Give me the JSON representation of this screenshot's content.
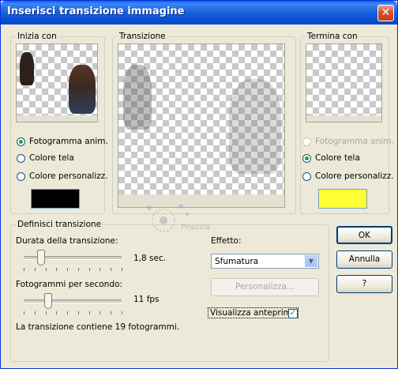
{
  "window": {
    "title": "Inserisci transizione immagine",
    "close_glyph": "✕"
  },
  "start_group": {
    "label": "Inizia con",
    "options": [
      {
        "label": "Fotogramma anim.",
        "selected": true,
        "disabled": false
      },
      {
        "label": "Colore tela",
        "selected": false,
        "disabled": false
      },
      {
        "label": "Colore personalizz.",
        "selected": false,
        "disabled": false
      }
    ],
    "custom_color": "#000000"
  },
  "transition_group": {
    "label": "Transizione"
  },
  "end_group": {
    "label": "Termina con",
    "options": [
      {
        "label": "Fotogramma anim.",
        "selected": false,
        "disabled": true
      },
      {
        "label": "Colore tela",
        "selected": true,
        "disabled": false
      },
      {
        "label": "Colore personalizz.",
        "selected": false,
        "disabled": false
      }
    ],
    "custom_color": "#ffff33"
  },
  "define_group": {
    "label": "Definisci transizione",
    "duration_label": "Durata della transizione:",
    "duration_value": "1,8 sec.",
    "duration_level": 0.18,
    "fps_label": "Fotogrammi per secondo:",
    "fps_value": "11 fps",
    "fps_level": 0.25,
    "frames_info": "La transizione contiene 19 fotogrammi.",
    "effect_label": "Effetto:",
    "effect_value": "Sfumatura",
    "customize_label": "Personalizza...",
    "preview_label": "Visualizza anteprima",
    "preview_checked": true
  },
  "buttons": {
    "ok": "OK",
    "cancel": "Annulla",
    "help": "?"
  },
  "watermark_text": "Pinuccia"
}
